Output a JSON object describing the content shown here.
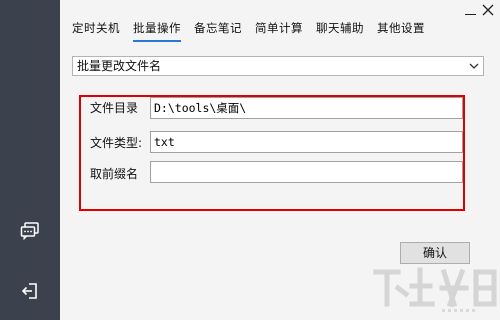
{
  "sidebar": {
    "icons": [
      "chat-icon",
      "exit-icon"
    ]
  },
  "window": {
    "minimize_icon": "minimize-icon",
    "close_icon": "close-icon"
  },
  "tabs": [
    {
      "label": "定时关机",
      "active": false
    },
    {
      "label": "批量操作",
      "active": true
    },
    {
      "label": "备忘笔记",
      "active": false
    },
    {
      "label": "简单计算",
      "active": false
    },
    {
      "label": "聊天辅助",
      "active": false
    },
    {
      "label": "其他设置",
      "active": false
    }
  ],
  "operation_select": {
    "value": "批量更改文件名",
    "icon": "chevron-down-icon"
  },
  "form": {
    "directory_label": "文件目录",
    "directory_value": "D:\\tools\\桌面\\",
    "type_label": "文件类型:",
    "type_value": "txt",
    "prefix_label": "取前缀名",
    "prefix_value": ""
  },
  "confirm_button": "确认",
  "colors": {
    "sidebar": "#3c414e",
    "highlight_box": "#e00000",
    "active_tab_underline": "#2a77d6"
  }
}
